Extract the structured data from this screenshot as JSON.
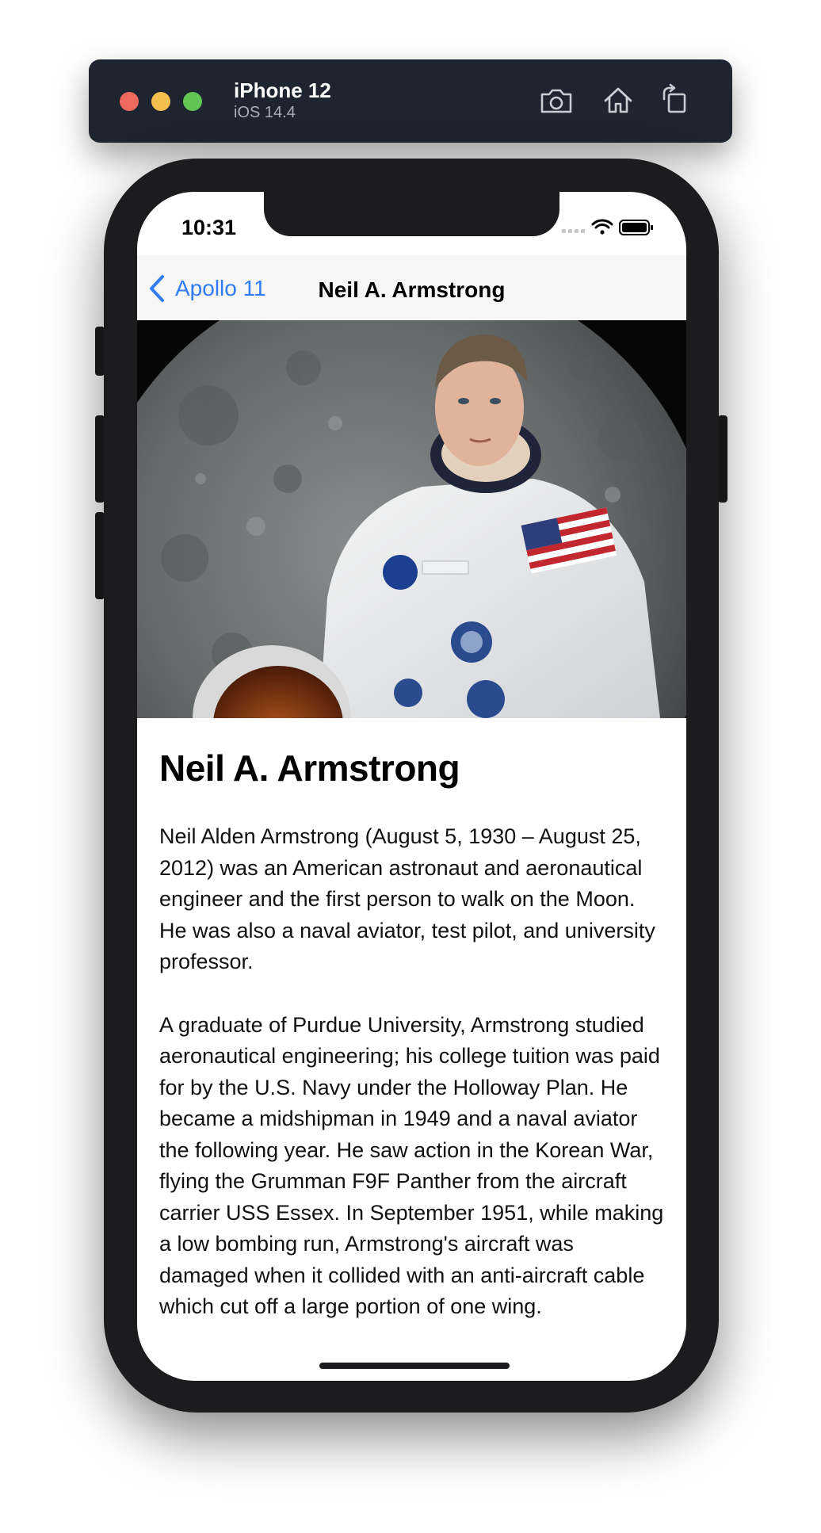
{
  "simulator": {
    "device_name": "iPhone 12",
    "os_version": "iOS 14.4",
    "icons": [
      "screenshot-icon",
      "home-icon",
      "rotate-icon"
    ]
  },
  "status_bar": {
    "time": "10:31",
    "icons": [
      "signal-icon",
      "wifi-icon",
      "battery-icon"
    ]
  },
  "nav": {
    "back_label": "Apollo 11",
    "title": "Neil A. Armstrong"
  },
  "hero_image": {
    "subject": "astronaut-portrait"
  },
  "article": {
    "heading": "Neil A. Armstrong",
    "paragraphs": [
      "Neil Alden Armstrong (August 5, 1930 – August 25, 2012) was an American astronaut and aeronautical engineer and the first person to walk on the Moon. He was also a naval aviator, test pilot, and university professor.",
      "A graduate of Purdue University, Armstrong studied aeronautical engineering; his college tuition was paid for by the U.S. Navy under the Holloway Plan. He became a midshipman in 1949 and a naval aviator the following year. He saw action in the Korean War, flying the Grumman F9F Panther from the aircraft carrier USS Essex. In September 1951, while making a low bombing run, Armstrong's aircraft was damaged when it collided with an anti-aircraft cable which cut off a large portion of one wing."
    ]
  },
  "colors": {
    "accent": "#2f7cf6",
    "titlebar": "#1e2430",
    "frame": "#1c1c1e"
  }
}
